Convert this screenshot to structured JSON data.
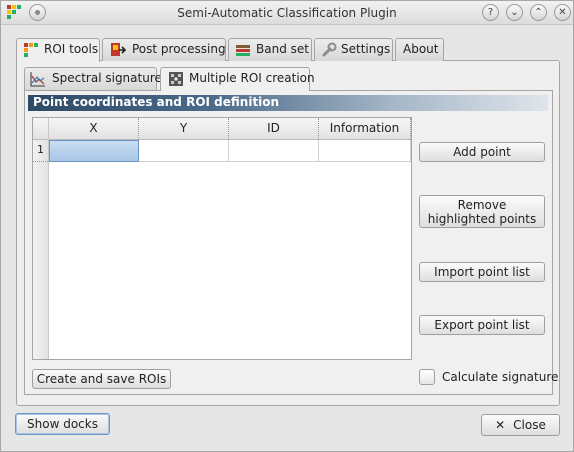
{
  "window": {
    "title": "Semi-Automatic Classification Plugin",
    "buttons": [
      "?",
      "⌄",
      "⌃",
      "✕"
    ]
  },
  "main_tabs": [
    {
      "label": "ROI tools",
      "icon": "roi-tools-icon",
      "active": true
    },
    {
      "label": "Post processing",
      "icon": "post-processing-icon",
      "active": false
    },
    {
      "label": "Band set",
      "icon": "band-set-icon",
      "active": false
    },
    {
      "label": "Settings",
      "icon": "settings-icon",
      "active": false
    },
    {
      "label": "About",
      "icon": "",
      "active": false
    }
  ],
  "sub_tabs": [
    {
      "label": "Spectral signature",
      "icon": "spectral-signature-icon",
      "active": false
    },
    {
      "label": "Multiple ROI creation",
      "icon": "multiple-roi-icon",
      "active": true
    }
  ],
  "section": {
    "title": "Point coordinates and ROI definition"
  },
  "table": {
    "columns": [
      "X",
      "Y",
      "ID",
      "Information"
    ],
    "rows": [
      {
        "index": "1",
        "cells": [
          "",
          "",
          "",
          ""
        ]
      }
    ]
  },
  "buttons": {
    "add_point": "Add point",
    "remove_line1": "Remove",
    "remove_line2": "highlighted points",
    "import_points": "Import point list",
    "export_points": "Export point list",
    "create_rois": "Create and save ROIs",
    "show_docks": "Show docks",
    "close": "Close"
  },
  "options": {
    "calculate_signature": "Calculate signature",
    "calculate_signature_checked": false
  },
  "colors": {
    "header_start": "#2d4a66",
    "selection": "#a7c6e6"
  }
}
